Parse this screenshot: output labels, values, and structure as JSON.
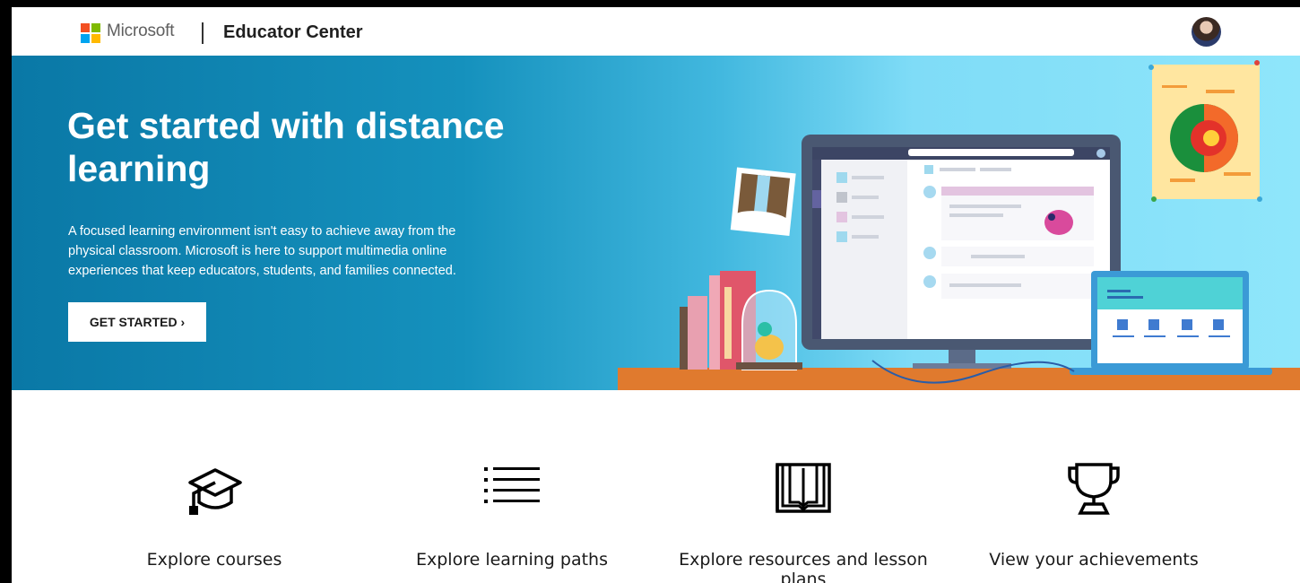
{
  "header": {
    "brand": "Microsoft",
    "site_title": "Educator Center",
    "logo_colors": [
      "#f25022",
      "#7fba00",
      "#00a4ef",
      "#ffb900"
    ],
    "avatar_icon": "user-avatar"
  },
  "hero": {
    "title": "Get started with distance learning",
    "description": "A focused learning environment isn't easy to achieve away from the physical classroom. Microsoft is here to support multimedia online experiences that keep educators, students, and families connected.",
    "cta_label": "GET STARTED ›"
  },
  "tiles": [
    {
      "label": "Explore courses",
      "icon": "graduation-cap-icon"
    },
    {
      "label": "Explore learning paths",
      "icon": "list-icon"
    },
    {
      "label": "Explore resources and lesson plans",
      "icon": "book-icon"
    },
    {
      "label": "View your achievements",
      "icon": "trophy-icon"
    }
  ]
}
